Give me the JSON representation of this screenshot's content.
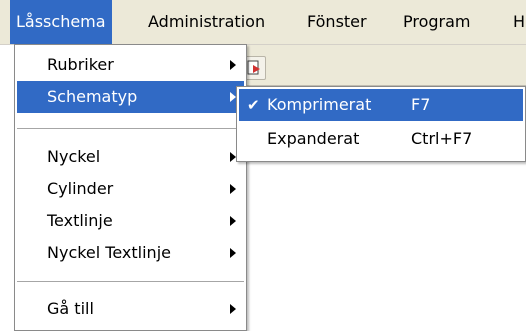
{
  "menubar": {
    "items": [
      "Låsschema",
      "Administration",
      "Fönster",
      "Program",
      "H"
    ]
  },
  "dropdown": {
    "items": [
      {
        "label": "Rubriker",
        "submenu": true
      },
      {
        "label": "Schematyp",
        "submenu": true
      },
      {
        "label": "Nyckel",
        "submenu": true
      },
      {
        "label": "Cylinder",
        "submenu": true
      },
      {
        "label": "Textlinje",
        "submenu": true
      },
      {
        "label": "Nyckel Textlinje",
        "submenu": true
      },
      {
        "label": "Gå till",
        "submenu": true
      }
    ]
  },
  "submenu": {
    "items": [
      {
        "label": "Komprimerat",
        "shortcut": "F7",
        "checked": true
      },
      {
        "label": "Expanderat",
        "shortcut": "Ctrl+F7",
        "checked": false
      }
    ],
    "check_glyph": "✔"
  },
  "colors": {
    "highlight": "#316ac5",
    "menubar_bg": "#ece9d8"
  }
}
